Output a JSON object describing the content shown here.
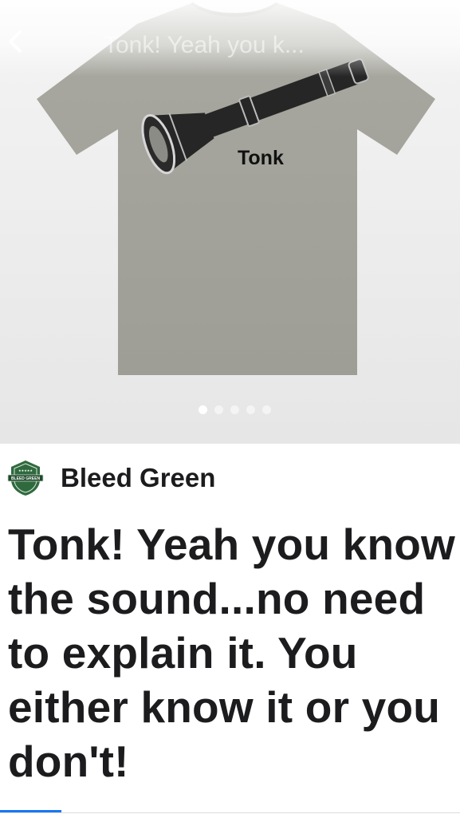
{
  "header": {
    "title": "Tonk! Yeah you k..."
  },
  "product": {
    "image": {
      "print_text": "Tonk",
      "icon": "flashlight-icon",
      "shirt_color": "#a4a49c"
    },
    "carousel": {
      "count": 5,
      "active": 0
    },
    "seller": {
      "name": "Bleed Green",
      "logo_icon": "shield-logo-icon",
      "logo_text": "BLEED GREEN",
      "logo_color": "#2f6a3e"
    },
    "title": "Tonk! Yeah you know the sound...no need to explain it. You either know it or you don't!"
  },
  "colors": {
    "accent": "#1877f2",
    "text": "#1c1c1e"
  }
}
